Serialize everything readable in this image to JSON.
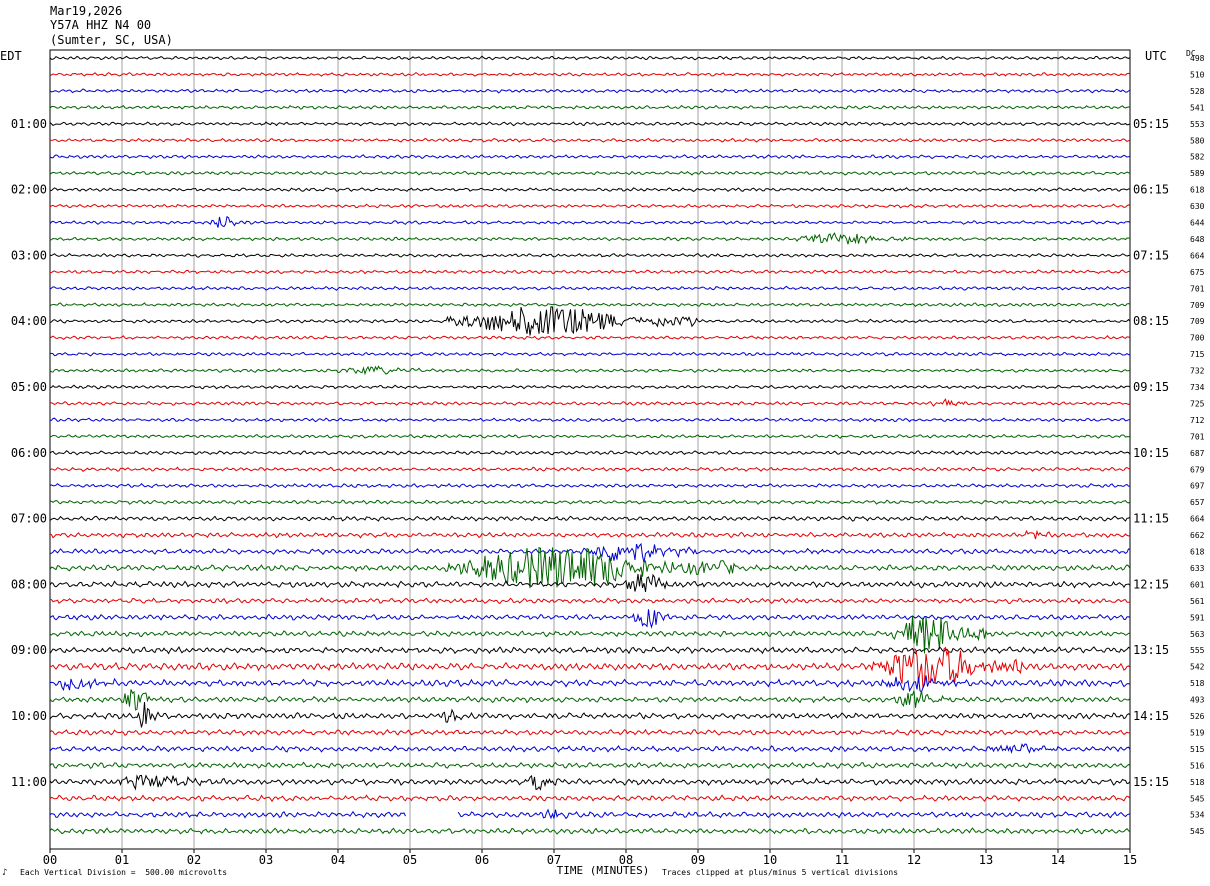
{
  "header": {
    "date": "Mar19,2026",
    "station": "Y57A HHZ N4 00",
    "location": "(Sumter, SC, USA)"
  },
  "left_zone": "EDT",
  "right_zone": "UTC",
  "dc_label": "DC",
  "footer": {
    "scale_note": "Each Vertical Division =  500.00 microvolts",
    "clip_note": "Traces clipped at plus/minus 5 vertical divisions",
    "logo_mark": "♪"
  },
  "colors": {
    "cycle": [
      "#000000",
      "#e00000",
      "#0000d0",
      "#006400"
    ],
    "grid": "#a0a0a0"
  },
  "chart_data": {
    "type": "line",
    "title": "Y57A HHZ N4 00",
    "xlabel": "TIME (MINUTES)",
    "ylabel": "",
    "x_ticks": [
      "00",
      "01",
      "02",
      "03",
      "04",
      "05",
      "06",
      "07",
      "08",
      "09",
      "10",
      "11",
      "12",
      "13",
      "14",
      "15"
    ],
    "xlim": [
      0,
      15
    ],
    "rows": 48,
    "minutes_per_row": 15,
    "left_time_labels": [
      "01:00",
      "02:00",
      "03:00",
      "04:00",
      "05:00",
      "06:00",
      "07:00",
      "08:00",
      "09:00",
      "10:00",
      "11:00"
    ],
    "right_time_labels": [
      "05:15",
      "06:15",
      "07:15",
      "08:15",
      "09:15",
      "10:15",
      "11:15",
      "12:15",
      "13:15",
      "14:15",
      "15:15"
    ],
    "dc_offsets": [
      498,
      510,
      528,
      541,
      553,
      580,
      582,
      589,
      618,
      630,
      644,
      648,
      664,
      675,
      701,
      709,
      709,
      700,
      715,
      732,
      734,
      725,
      712,
      701,
      687,
      679,
      697,
      657,
      664,
      662,
      618,
      633,
      601,
      561,
      591,
      563,
      555,
      542,
      518,
      493,
      526,
      519,
      515,
      516,
      518,
      545,
      534,
      545
    ],
    "noise_level": [
      0.55,
      0.55,
      0.55,
      0.55,
      0.55,
      0.55,
      0.55,
      0.55,
      0.55,
      0.55,
      0.55,
      0.55,
      0.55,
      0.55,
      0.55,
      0.55,
      0.55,
      0.55,
      0.55,
      0.55,
      0.55,
      0.55,
      0.55,
      0.55,
      0.6,
      0.6,
      0.6,
      0.6,
      0.75,
      0.8,
      0.85,
      0.95,
      1.0,
      0.85,
      0.9,
      0.9,
      1.0,
      1.2,
      1.1,
      0.9,
      1.0,
      0.85,
      0.9,
      0.9,
      1.0,
      0.9,
      0.9,
      0.9
    ],
    "events": [
      {
        "row": 10,
        "start_min": 2.2,
        "end_min": 2.8,
        "amplitude_div": 1.4
      },
      {
        "row": 11,
        "start_min": 10.3,
        "end_min": 12.0,
        "amplitude_div": 1.3
      },
      {
        "row": 16,
        "start_min": 5.5,
        "end_min": 9.0,
        "amplitude_div": 3.5
      },
      {
        "row": 19,
        "start_min": 4.0,
        "end_min": 5.2,
        "amplitude_div": 1.0
      },
      {
        "row": 21,
        "start_min": 12.2,
        "end_min": 12.7,
        "amplitude_div": 1.0
      },
      {
        "row": 29,
        "start_min": 13.5,
        "end_min": 13.9,
        "amplitude_div": 1.2
      },
      {
        "row": 30,
        "start_min": 7.4,
        "end_min": 9.0,
        "amplitude_div": 2.5
      },
      {
        "row": 31,
        "start_min": 5.5,
        "end_min": 9.5,
        "amplitude_div": 5.0
      },
      {
        "row": 32,
        "start_min": 8.0,
        "end_min": 8.7,
        "amplitude_div": 2.5
      },
      {
        "row": 34,
        "start_min": 8.1,
        "end_min": 8.6,
        "amplitude_div": 3.0
      },
      {
        "row": 35,
        "start_min": 11.7,
        "end_min": 13.0,
        "amplitude_div": 5.0
      },
      {
        "row": 37,
        "start_min": 11.4,
        "end_min": 13.5,
        "amplitude_div": 5.0
      },
      {
        "row": 38,
        "start_min": 0.0,
        "end_min": 0.9,
        "amplitude_div": 1.6
      },
      {
        "row": 38,
        "start_min": 11.5,
        "end_min": 12.7,
        "amplitude_div": 2.0
      },
      {
        "row": 39,
        "start_min": 1.0,
        "end_min": 1.5,
        "amplitude_div": 3.0
      },
      {
        "row": 39,
        "start_min": 11.7,
        "end_min": 12.5,
        "amplitude_div": 2.0
      },
      {
        "row": 40,
        "start_min": 1.2,
        "end_min": 1.5,
        "amplitude_div": 3.0
      },
      {
        "row": 40,
        "start_min": 5.3,
        "end_min": 5.9,
        "amplitude_div": 1.3
      },
      {
        "row": 42,
        "start_min": 13.0,
        "end_min": 14.0,
        "amplitude_div": 1.5
      },
      {
        "row": 44,
        "start_min": 0.8,
        "end_min": 2.3,
        "amplitude_div": 1.5
      },
      {
        "row": 44,
        "start_min": 6.6,
        "end_min": 7.1,
        "amplitude_div": 2.0
      },
      {
        "row": 46,
        "start_min": 6.8,
        "end_min": 7.2,
        "amplitude_div": 1.3
      }
    ],
    "gaps": [
      {
        "row": 46,
        "start_min": 4.95,
        "end_min": 5.65
      }
    ],
    "clip_divisions": 5
  }
}
